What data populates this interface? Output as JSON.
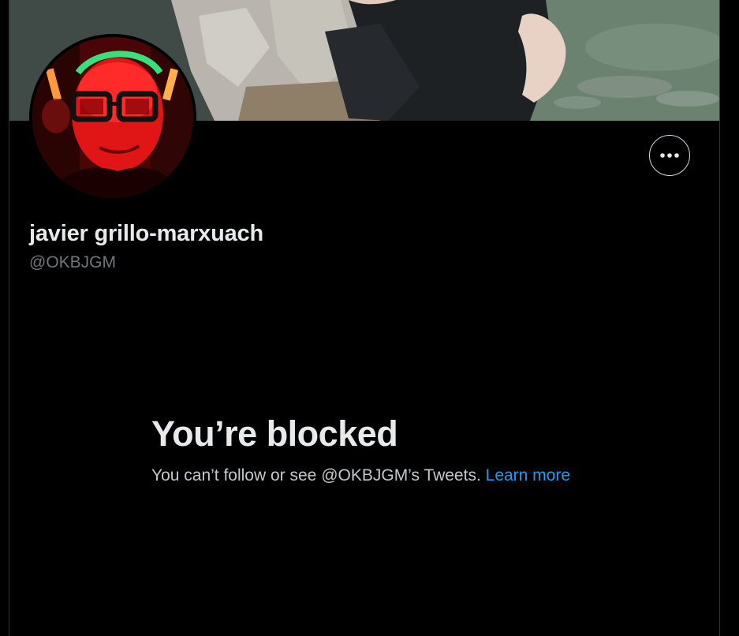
{
  "profile": {
    "display_name": "javier grillo-marxuach",
    "handle": "@OKBJGM"
  },
  "more_button": {
    "icon": "more-horizontal-icon"
  },
  "blocked": {
    "title": "You’re blocked",
    "message": "You can’t follow or see @OKBJGM’s Tweets.",
    "link_label": "Learn more"
  },
  "colors": {
    "background": "#000000",
    "text_primary": "#e7e9ea",
    "text_secondary": "#71767b",
    "link": "#1d9bf0",
    "border": "#2f3336"
  }
}
